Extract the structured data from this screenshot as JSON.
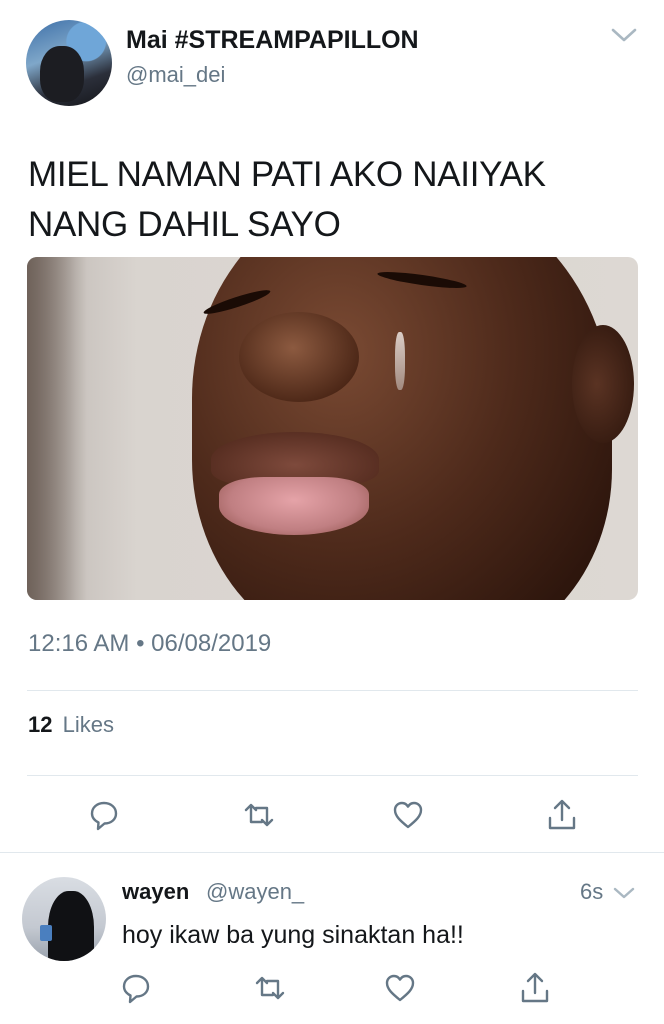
{
  "tweet": {
    "display_name": "Mai #STREAMPAPILLON",
    "handle": "@mai_dei",
    "text_line1": "MIEL NAMAN PATI AKO NAIIYAK",
    "text_line2": "NANG DAHIL SAYO",
    "timestamp": "12:16 AM • 06/08/2019",
    "likes_count": "12",
    "likes_label": "Likes",
    "icons": {
      "menu": "chevron-down-icon",
      "reply": "reply-icon",
      "retweet": "retweet-icon",
      "like": "heart-icon",
      "share": "share-icon"
    }
  },
  "reply": {
    "display_name": "wayen",
    "handle": "@wayen_",
    "time": "6s",
    "text": "hoy ikaw ba yung sinaktan ha!!"
  },
  "colors": {
    "text_primary": "#14171a",
    "text_secondary": "#657786",
    "divider": "#e1e8ed"
  }
}
